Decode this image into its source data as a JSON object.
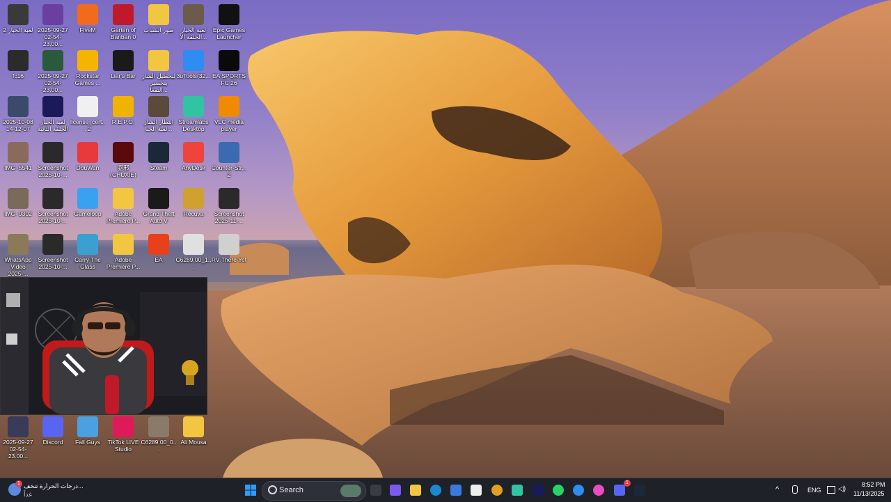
{
  "desktop": {
    "icons": [
      {
        "label": "لعبة الحبار 2",
        "icon": "video-thumbnail-icon",
        "color": "#3a3a3a"
      },
      {
        "label": "2025-09-27 02-54-23.00...",
        "icon": "video-file-icon",
        "color": "#6a3fa0"
      },
      {
        "label": "FiveM",
        "icon": "fivem-icon",
        "color": "#f26a1b"
      },
      {
        "label": "Garten of Banban 0",
        "icon": "banban-icon",
        "color": "#c01a2a"
      },
      {
        "label": "صور الشباب",
        "icon": "folder-icon",
        "color": "#f2c640"
      },
      {
        "label": "لعبة الحبار الحلقة الأ...",
        "icon": "video-thumbnail-icon",
        "color": "#6b5b4a"
      },
      {
        "label": "Epic Games Launcher",
        "icon": "epic-games-icon",
        "color": "#111111"
      },
      {
        "label": "fc16",
        "icon": "video-thumbnail-icon",
        "color": "#2b2b2b"
      },
      {
        "label": "2025-09-27 02-54-23.00...",
        "icon": "video-file-icon",
        "color": "#2a5a3a"
      },
      {
        "label": "Rockstar Games ...",
        "icon": "rockstar-icon",
        "color": "#f5b400"
      },
      {
        "label": "Liar's Bar",
        "icon": "liars-bar-icon",
        "color": "#1a1a1a"
      },
      {
        "label": "لتحطيل الشاز يتحضير التفعا...",
        "icon": "folder-icon",
        "color": "#f2c640"
      },
      {
        "label": "3uTools(32...",
        "icon": "3utools-icon",
        "color": "#2f8cf0"
      },
      {
        "label": "EA SPORTS FC 26",
        "icon": "ea-fc-icon",
        "color": "#0a0a0a"
      },
      {
        "label": "2025-10-08 14-12-07",
        "icon": "video-thumbnail-icon",
        "color": "#3a4a6a"
      },
      {
        "label": "لعبة الحبار الحلقة الثانية",
        "icon": "premiere-icon",
        "color": "#1a1a5a"
      },
      {
        "label": "license_cert... 2",
        "icon": "document-icon",
        "color": "#f0f0f0"
      },
      {
        "label": "R.E.P.O.",
        "icon": "repo-icon",
        "color": "#f0b400"
      },
      {
        "label": "انتظار الشاز لعبة الحبا...",
        "icon": "video-thumbnail-icon",
        "color": "#5a4a3a"
      },
      {
        "label": "Streamlabs Desktop",
        "icon": "streamlabs-icon",
        "color": "#31c3a2"
      },
      {
        "label": "VLC media player",
        "icon": "vlc-icon",
        "color": "#f08a00"
      },
      {
        "label": "IMG_5541",
        "icon": "image-thumbnail-icon",
        "color": "#8a6a5a"
      },
      {
        "label": "Screenshot 2025-10-...",
        "icon": "image-thumbnail-icon",
        "color": "#2a2a2a"
      },
      {
        "label": "DouWan",
        "icon": "douwan-icon",
        "color": "#e83a3a"
      },
      {
        "label": "驱邪 (CHUXIE)",
        "icon": "chuxie-icon",
        "color": "#5a0a0a"
      },
      {
        "label": "Steam",
        "icon": "steam-icon",
        "color": "#1b2838"
      },
      {
        "label": "AnyDesk",
        "icon": "anydesk-icon",
        "color": "#ef443b"
      },
      {
        "label": "Counter-Str... 2",
        "icon": "counter-strike-icon",
        "color": "#3a6ab0"
      },
      {
        "label": "IMG_9302",
        "icon": "image-thumbnail-icon",
        "color": "#7a6a5a"
      },
      {
        "label": "Screenshot 2025-10-...",
        "icon": "image-thumbnail-icon",
        "color": "#2a2a2a"
      },
      {
        "label": "Gameloop",
        "icon": "gameloop-icon",
        "color": "#3aa0f0"
      },
      {
        "label": "Adobe Premiere P...",
        "icon": "folder-icon",
        "color": "#f2c640"
      },
      {
        "label": "Grand Theft Auto V",
        "icon": "gta-icon",
        "color": "#1a1a1a"
      },
      {
        "label": "Recuva",
        "icon": "recuva-icon",
        "color": "#d0a030"
      },
      {
        "label": "Screenshot 2025-11-...",
        "icon": "image-thumbnail-icon",
        "color": "#2a2a2a"
      },
      {
        "label": "WhatsApp Video 2025-...",
        "icon": "video-thumbnail-icon",
        "color": "#8a7a5a"
      },
      {
        "label": "Screenshot 2025-10-...",
        "icon": "image-thumbnail-icon",
        "color": "#2a2a2a"
      },
      {
        "label": "Carry The Glass",
        "icon": "carry-glass-icon",
        "color": "#3aa0d0"
      },
      {
        "label": "Adobe Premiere P...",
        "icon": "folder-icon",
        "color": "#f2c640"
      },
      {
        "label": "EA",
        "icon": "ea-icon",
        "color": "#e8401a"
      },
      {
        "label": "C6289.00_1...",
        "icon": "image-thumbnail-icon",
        "color": "#e0e0e0"
      },
      {
        "label": "RV There Yet",
        "icon": "rv-there-yet-icon",
        "color": "#d0d0d0"
      }
    ],
    "bottom_icons": [
      {
        "label": "2025-09-27 02-54-23.00...",
        "icon": "video-file-icon",
        "color": "#3a3a5a"
      },
      {
        "label": "Discord",
        "icon": "discord-icon",
        "color": "#5865f2"
      },
      {
        "label": "Fall Guys",
        "icon": "fall-guys-icon",
        "color": "#4aa0e0"
      },
      {
        "label": "TikTok LIVE Studio",
        "icon": "tiktok-icon",
        "color": "#e01a5a"
      },
      {
        "label": "C6289.00_0...",
        "icon": "image-thumbnail-icon",
        "color": "#8a7a6a"
      },
      {
        "label": "Ali Mousa",
        "icon": "folder-icon",
        "color": "#f2c640"
      }
    ]
  },
  "taskbar": {
    "weather_text": "درجات الحرارة تنخف...",
    "weather_sub": "غداً",
    "weather_badge": "1",
    "search_label": "Search",
    "apps": [
      {
        "name": "start-button",
        "icon": "windows-logo-icon",
        "color": "#2d9cff"
      },
      {
        "name": "task-view-button",
        "icon": "task-view-icon",
        "color": "#3a3c44"
      },
      {
        "name": "copilot-button",
        "icon": "copilot-icon",
        "color": "#7a5af0"
      },
      {
        "name": "file-explorer-button",
        "icon": "folder-icon",
        "color": "#f2c640"
      },
      {
        "name": "edge-button",
        "icon": "edge-icon",
        "color": "#1a8ad0"
      },
      {
        "name": "store-button",
        "icon": "store-icon",
        "color": "#3a7ae0"
      },
      {
        "name": "app-button",
        "icon": "pin-icon",
        "color": "#eeeeee"
      },
      {
        "name": "chrome-button",
        "icon": "chrome-icon",
        "color": "#e0a020"
      },
      {
        "name": "streamlabs-button",
        "icon": "streamlabs-icon",
        "color": "#31c3a2"
      },
      {
        "name": "premiere-button",
        "icon": "premiere-icon",
        "color": "#1a1a5a"
      },
      {
        "name": "whatsapp-button",
        "icon": "whatsapp-icon",
        "color": "#25d366"
      },
      {
        "name": "photos-button",
        "icon": "photos-icon",
        "color": "#2f8cf0"
      },
      {
        "name": "itunes-button",
        "icon": "itunes-icon",
        "color": "#ea4cc0"
      },
      {
        "name": "discord-button",
        "icon": "discord-icon",
        "color": "#5865f2"
      },
      {
        "name": "steam-button",
        "icon": "steam-icon",
        "color": "#1b2838"
      }
    ],
    "discord_badge": "1",
    "language": "ENG",
    "time": "8:52 PM",
    "date": "11/13/2025"
  }
}
